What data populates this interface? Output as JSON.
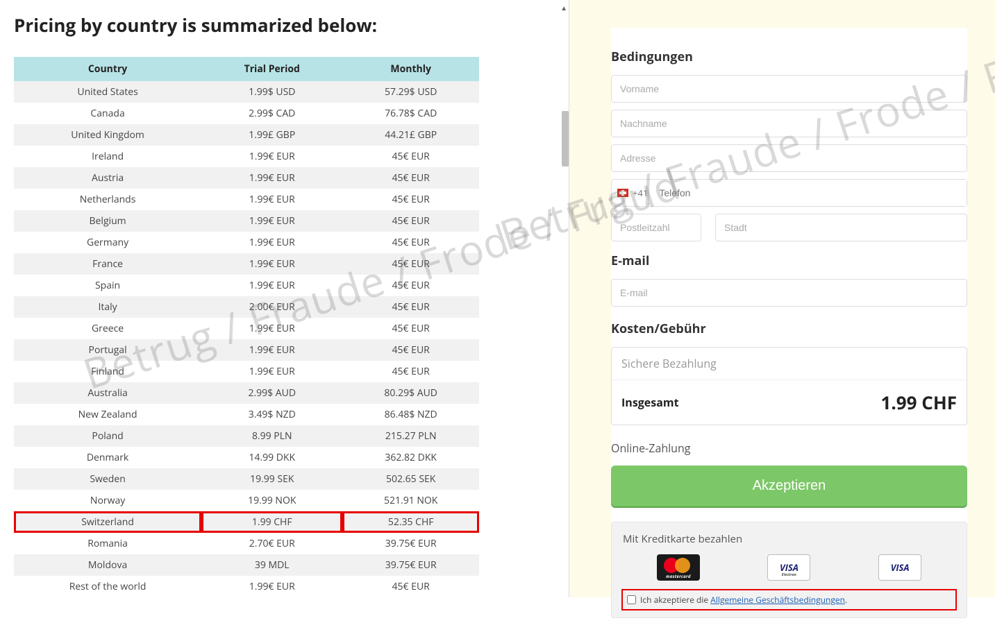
{
  "watermark": "Betrug / Fraude / Frode / Fraud",
  "left": {
    "heading": "Pricing by country is summarized below:",
    "headers": {
      "country": "Country",
      "trial": "Trial Period",
      "monthly": "Monthly"
    },
    "rows": [
      {
        "country": "United States",
        "trial": "1.99$ USD",
        "monthly": "57.29$ USD"
      },
      {
        "country": "Canada",
        "trial": "2.99$ CAD",
        "monthly": "76.78$ CAD"
      },
      {
        "country": "United Kingdom",
        "trial": "1.99£ GBP",
        "monthly": "44.21£ GBP"
      },
      {
        "country": "Ireland",
        "trial": "1.99€ EUR",
        "monthly": "45€ EUR"
      },
      {
        "country": "Austria",
        "trial": "1.99€ EUR",
        "monthly": "45€ EUR"
      },
      {
        "country": "Netherlands",
        "trial": "1.99€ EUR",
        "monthly": "45€ EUR"
      },
      {
        "country": "Belgium",
        "trial": "1.99€ EUR",
        "monthly": "45€ EUR"
      },
      {
        "country": "Germany",
        "trial": "1.99€ EUR",
        "monthly": "45€ EUR"
      },
      {
        "country": "France",
        "trial": "1.99€ EUR",
        "monthly": "45€ EUR"
      },
      {
        "country": "Spain",
        "trial": "1.99€ EUR",
        "monthly": "45€ EUR"
      },
      {
        "country": "Italy",
        "trial": "2.00€ EUR",
        "monthly": "45€ EUR"
      },
      {
        "country": "Greece",
        "trial": "1.99€ EUR",
        "monthly": "45€ EUR"
      },
      {
        "country": "Portugal",
        "trial": "1.99€ EUR",
        "monthly": "45€ EUR"
      },
      {
        "country": "Finland",
        "trial": "1.99€ EUR",
        "monthly": "45€ EUR"
      },
      {
        "country": "Australia",
        "trial": "2.99$ AUD",
        "monthly": "80.29$ AUD"
      },
      {
        "country": "New Zealand",
        "trial": "3.49$ NZD",
        "monthly": "86.48$ NZD"
      },
      {
        "country": "Poland",
        "trial": "8.99 PLN",
        "monthly": "215.27 PLN"
      },
      {
        "country": "Denmark",
        "trial": "14.99 DKK",
        "monthly": "362.82 DKK"
      },
      {
        "country": "Sweden",
        "trial": "19.99 SEK",
        "monthly": "502.65 SEK"
      },
      {
        "country": "Norway",
        "trial": "19.99 NOK",
        "monthly": "521.91 NOK"
      },
      {
        "country": "Switzerland",
        "trial": "1.99 CHF",
        "monthly": "52.35 CHF",
        "highlight": true
      },
      {
        "country": "Romania",
        "trial": "2.70€ EUR",
        "monthly": "39.75€ EUR"
      },
      {
        "country": "Moldova",
        "trial": "39 MDL",
        "monthly": "39.75€ EUR"
      },
      {
        "country": "Rest of the world",
        "trial": "1.99€ EUR",
        "monthly": "45€ EUR"
      }
    ]
  },
  "form": {
    "conditions_title": "Bedingungen",
    "firstname_ph": "Vorname",
    "lastname_ph": "Nachname",
    "address_ph": "Adresse",
    "phone_code": "+41",
    "phone_ph": "Telefon",
    "zip_ph": "Postleitzahl",
    "city_ph": "Stadt",
    "email_title": "E-mail",
    "email_ph": "E-mail",
    "cost_title": "Kosten/Gebühr",
    "secure_payment": "Sichere Bezahlung",
    "total_label": "Insgesamt",
    "total_value": "1.99 CHF",
    "online_title": "Online-Zahlung",
    "accept_btn": "Akzeptieren",
    "cc_title": "Mit Kreditkarte bezahlen",
    "cc_mastercard": "mastercard",
    "cc_visa": "VISA",
    "cc_visa_electron_sub": "Electron",
    "terms_prefix": "Ich akzeptiere die ",
    "terms_link": "Allgemeine Geschäftsbedingungen",
    "terms_suffix": "."
  }
}
